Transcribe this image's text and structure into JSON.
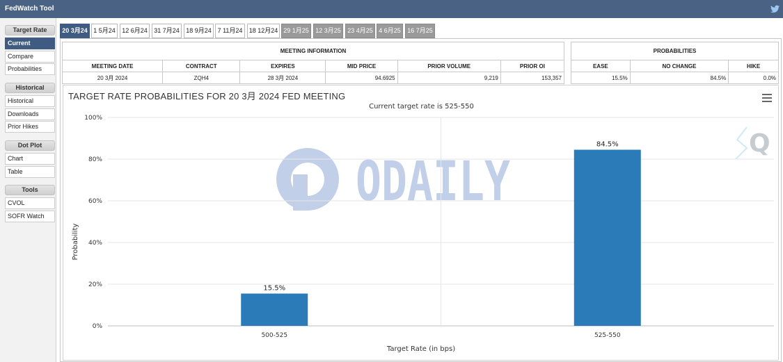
{
  "app": {
    "title": "FedWatch Tool",
    "social_icon": "twitter-bird-icon"
  },
  "sidebar": {
    "sections": [
      {
        "heading": "Target Rate",
        "items": [
          "Current",
          "Compare",
          "Probabilities"
        ]
      },
      {
        "heading": "Historical",
        "items": [
          "Historical",
          "Downloads",
          "Prior Hikes"
        ]
      },
      {
        "heading": "Dot Plot",
        "items": [
          "Chart",
          "Table"
        ]
      },
      {
        "heading": "Tools",
        "items": [
          "CVOL",
          "SOFR Watch"
        ]
      }
    ],
    "active_item": "Current"
  },
  "tabs": [
    "20 3月24",
    "1 5月24",
    "12 6月24",
    "31 7月24",
    "18 9月24",
    "7 11月24",
    "18 12月24",
    "29 1月25",
    "12 3月25",
    "23 4月25",
    "4 6月25",
    "16 7月25"
  ],
  "meeting_info": {
    "caption": "MEETING INFORMATION",
    "headers": [
      "MEETING DATE",
      "CONTRACT",
      "EXPIRES",
      "MID PRICE",
      "PRIOR VOLUME",
      "PRIOR OI"
    ],
    "row": [
      "20 3月 2024",
      "ZQH4",
      "28 3月 2024",
      "94.6925",
      "9,219",
      "153,357"
    ]
  },
  "probabilities": {
    "caption": "PROBABILITIES",
    "headers": [
      "EASE",
      "NO CHANGE",
      "HIKE"
    ],
    "row": [
      "15.5%",
      "84.5%",
      "0.0%"
    ]
  },
  "chart": {
    "title": "TARGET RATE PROBABILITIES FOR 20 3月 2024 FED MEETING",
    "subtitle": "Current target rate is 525-550",
    "menu_icon": "hamburger-menu-icon",
    "watermark": "ODAILY"
  },
  "chart_data": {
    "type": "bar",
    "title": "TARGET RATE PROBABILITIES FOR 20 3月 2024 FED MEETING",
    "subtitle": "Current target rate is 525-550",
    "categories": [
      "500-525",
      "525-550"
    ],
    "values": [
      15.5,
      84.5
    ],
    "data_labels": [
      "15.5%",
      "84.5%"
    ],
    "xlabel": "Target Rate (in bps)",
    "ylabel": "Probability",
    "ylim": [
      0,
      100
    ],
    "yticks": [
      "0%",
      "20%",
      "40%",
      "60%",
      "80%",
      "100%"
    ],
    "bar_color": "#2b7bb9",
    "grid": true
  }
}
